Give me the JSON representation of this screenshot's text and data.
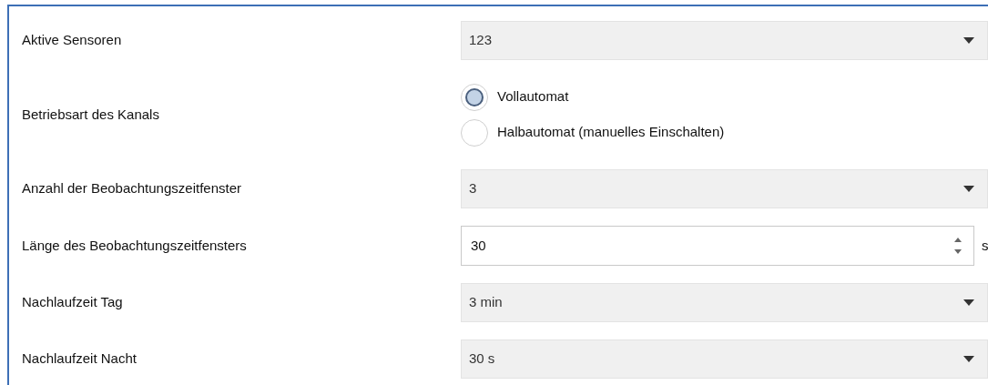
{
  "rows": [
    {
      "kind": "dropdown",
      "label": "Aktive Sensoren",
      "value": "123"
    },
    {
      "kind": "radio",
      "label": "Betriebsart des Kanals",
      "options": [
        {
          "label": "Vollautomat",
          "selected": true
        },
        {
          "label": "Halbautomat (manuelles Einschalten)",
          "selected": false
        }
      ]
    },
    {
      "kind": "dropdown",
      "label": "Anzahl der Beobachtungszeitfenster",
      "value": "3"
    },
    {
      "kind": "spin",
      "label": "Länge des Beobachtungszeitfensters",
      "value": "30",
      "unit": "s"
    },
    {
      "kind": "dropdown",
      "label": "Nachlaufzeit Tag",
      "value": "3 min"
    },
    {
      "kind": "dropdown",
      "label": "Nachlaufzeit Nacht",
      "value": "30 s"
    }
  ]
}
